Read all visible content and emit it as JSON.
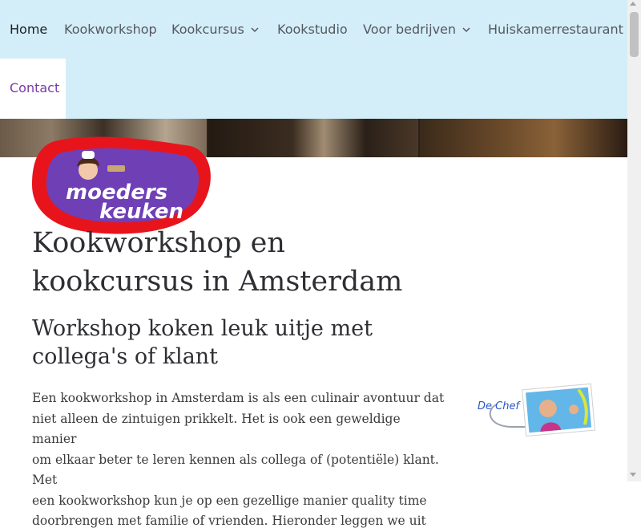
{
  "nav": {
    "items": [
      {
        "label": "Home",
        "active": true
      },
      {
        "label": "Kookworkshop"
      },
      {
        "label": "Kookcursus",
        "has_dropdown": true
      },
      {
        "label": "Kookstudio"
      },
      {
        "label": "Voor bedrijven",
        "has_dropdown": true
      },
      {
        "label": "Huiskamerrestaurant"
      }
    ],
    "contact": "Contact"
  },
  "logo": {
    "line1": "moeders",
    "line2": "keuken"
  },
  "page": {
    "title_line1": "Kookworkshop en",
    "title_line2": "kookcursus in Amsterdam",
    "subtitle_line1": "Workshop koken leuk uitje met",
    "subtitle_line2": "collega's of klant",
    "paragraph_lines": [
      "Een kookworkshop in Amsterdam is als een culinair avontuur dat",
      "niet alleen de zintuigen prikkelt. Het is ook een geweldige manier",
      "om elkaar beter te leren kennen als collega of (potentiële) klant. Met",
      "een kookworkshop kun je op een gezellige manier quality time",
      "doorbrengen met familie of vrienden. Hieronder leggen we uit"
    ]
  },
  "chef_badge": {
    "label": "De Chef"
  },
  "colors": {
    "nav_bg": "#d3eef8",
    "contact_text": "#7a3aa6",
    "logo_red": "#e8141c",
    "logo_purple": "#6f3fb5"
  },
  "icons": {
    "dropdown": "chevron-down-icon",
    "scroll_up": "scroll-up-arrow-icon",
    "scroll_down": "scroll-down-arrow-icon"
  }
}
